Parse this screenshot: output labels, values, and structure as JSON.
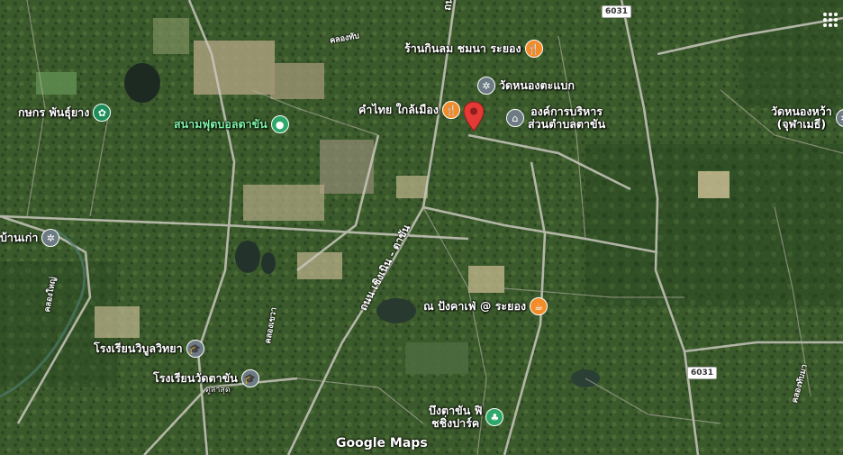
{
  "map": {
    "brand": "Google Maps",
    "pois": {
      "restaurant_chomna": "ร้านกินลม ชมนา ระยอง",
      "wat_nong_tabaek": "วัดหนองตะแบก",
      "kham_thai": "คำไทย ใกล้เมือง",
      "sao_admin_1": "องค์การบริหาร",
      "sao_admin_2": "ส่วนตำบลตาขัน",
      "wat_nong_wa_1": "วัดหนองหว้า",
      "wat_nong_wa_2": "(จุฬาเมธี)",
      "kaset_nursery": "กษกร พันธุ์ยาง",
      "football_field": "สนามฟุตบอลตาขัน",
      "ban_kao": "บ้านเก่า",
      "cafe": "ณ ปังคาเฟ่ @ ระยอง",
      "school_1": "โรงเรียนวิบูลวิทยา",
      "school_2": "โรงเรียนวัดตาขัน",
      "school_2_sub": "ดูล่าสุด",
      "park_1": "บึงตาขัน ฟิ",
      "park_2": "ชชิ่งปาร์ค"
    },
    "roads": {
      "main_road": "ถนน เชิงเนิน - ตาขัน",
      "route_top": "6031",
      "route_right": "6031",
      "canal_left": "คลองใหญ่",
      "canal_top": "คลองทับ",
      "canal_mid": "คลองเขวา",
      "canal_right": "คลองทับมา",
      "road_top_center": "ถนน เชิง"
    },
    "icons": {
      "restaurant": "fork-knife-icon",
      "temple": "temple-icon",
      "government": "building-icon",
      "cafe": "cup-icon",
      "school": "graduation-cap-icon",
      "park": "tree-icon",
      "stadium": "stadium-icon",
      "nursery": "flower-icon",
      "marker": "red-location-pin"
    }
  }
}
